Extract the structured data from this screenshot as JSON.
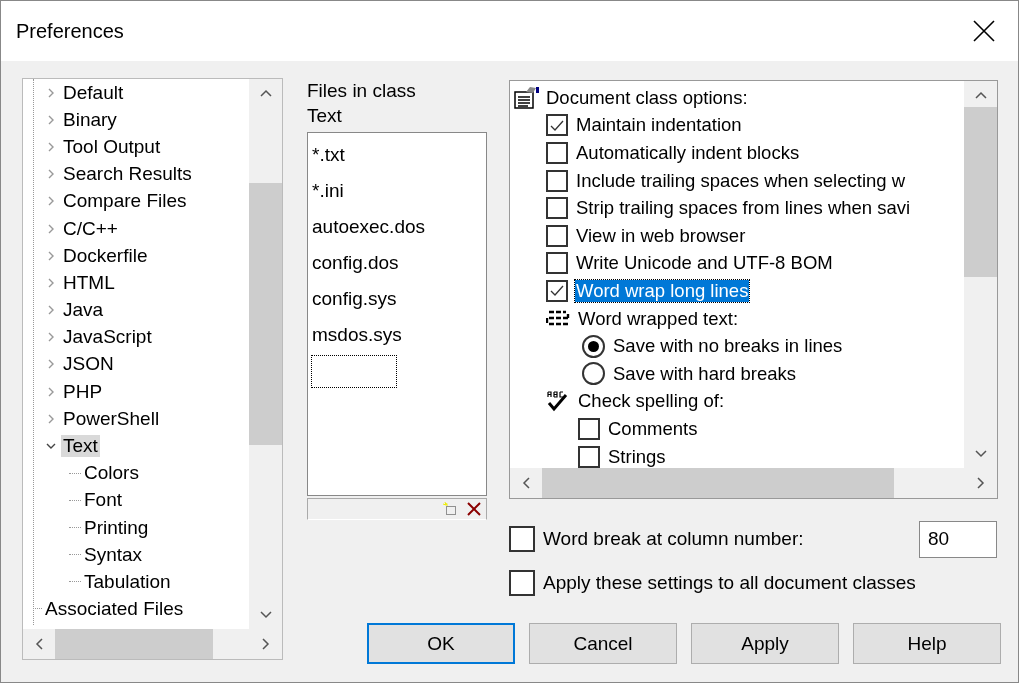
{
  "window": {
    "title": "Preferences"
  },
  "tree": {
    "items": [
      {
        "label": "Default",
        "expanded": false,
        "selected": false
      },
      {
        "label": "Binary",
        "expanded": false,
        "selected": false
      },
      {
        "label": "Tool Output",
        "expanded": false,
        "selected": false
      },
      {
        "label": "Search Results",
        "expanded": false,
        "selected": false
      },
      {
        "label": "Compare Files",
        "expanded": false,
        "selected": false
      },
      {
        "label": "C/C++",
        "expanded": false,
        "selected": false
      },
      {
        "label": "Dockerfile",
        "expanded": false,
        "selected": false
      },
      {
        "label": "HTML",
        "expanded": false,
        "selected": false
      },
      {
        "label": "Java",
        "expanded": false,
        "selected": false
      },
      {
        "label": "JavaScript",
        "expanded": false,
        "selected": false
      },
      {
        "label": "JSON",
        "expanded": false,
        "selected": false
      },
      {
        "label": "PHP",
        "expanded": false,
        "selected": false
      },
      {
        "label": "PowerShell",
        "expanded": false,
        "selected": false
      },
      {
        "label": "Text",
        "expanded": true,
        "selected": true,
        "children": [
          {
            "label": "Colors",
            "selected": false
          },
          {
            "label": "Font",
            "selected": false
          },
          {
            "label": "Printing",
            "selected": false
          },
          {
            "label": "Syntax",
            "selected": false
          },
          {
            "label": "Tabulation",
            "selected": false
          }
        ]
      }
    ],
    "next_root_item": {
      "label": "Associated Files",
      "selected": false
    }
  },
  "files": {
    "label": "Files in class",
    "class_name": "Text",
    "items": [
      "*.txt",
      "*.ini",
      "autoexec.dos",
      "config.dos",
      "config.sys",
      "msdos.sys"
    ]
  },
  "options": {
    "items": [
      {
        "kind": "section",
        "label": "Document class options:",
        "selected": false,
        "children": [
          {
            "kind": "checkbox",
            "label": "Maintain indentation",
            "checked": true,
            "selected": false
          },
          {
            "kind": "checkbox",
            "label": "Automatically indent blocks",
            "checked": false,
            "selected": false
          },
          {
            "kind": "checkbox",
            "label": "Include trailing spaces when selecting w",
            "checked": false,
            "selected": false
          },
          {
            "kind": "checkbox",
            "label": "Strip trailing spaces from lines when savi",
            "checked": false,
            "selected": false
          },
          {
            "kind": "checkbox",
            "label": "View in web browser",
            "checked": false,
            "selected": false
          },
          {
            "kind": "checkbox",
            "label": "Write Unicode and UTF-8 BOM",
            "checked": false,
            "selected": false
          },
          {
            "kind": "checkbox",
            "label": "Word wrap long lines",
            "checked": true,
            "selected": true
          },
          {
            "kind": "wrap-group",
            "label": "Word wrapped text:",
            "selected": false,
            "children": [
              {
                "kind": "radio",
                "label": "Save with no breaks in lines",
                "checked": true,
                "selected": false
              },
              {
                "kind": "radio",
                "label": "Save with hard breaks",
                "checked": false,
                "selected": false
              }
            ]
          },
          {
            "kind": "spell-group",
            "label": "Check spelling of:",
            "selected": false,
            "children": [
              {
                "kind": "checkbox",
                "label": "Comments",
                "checked": false,
                "selected": false
              },
              {
                "kind": "checkbox",
                "label": "Strings",
                "checked": false,
                "selected": false
              }
            ]
          }
        ]
      }
    ]
  },
  "word_break": {
    "label": "Word break at column number:",
    "checked": false,
    "value": "80"
  },
  "apply_all": {
    "label": "Apply these settings to all document classes",
    "checked": false
  },
  "buttons": [
    {
      "label": "OK",
      "default": true
    },
    {
      "label": "Cancel",
      "default": false
    },
    {
      "label": "Apply",
      "default": false
    },
    {
      "label": "Help",
      "default": false
    }
  ]
}
